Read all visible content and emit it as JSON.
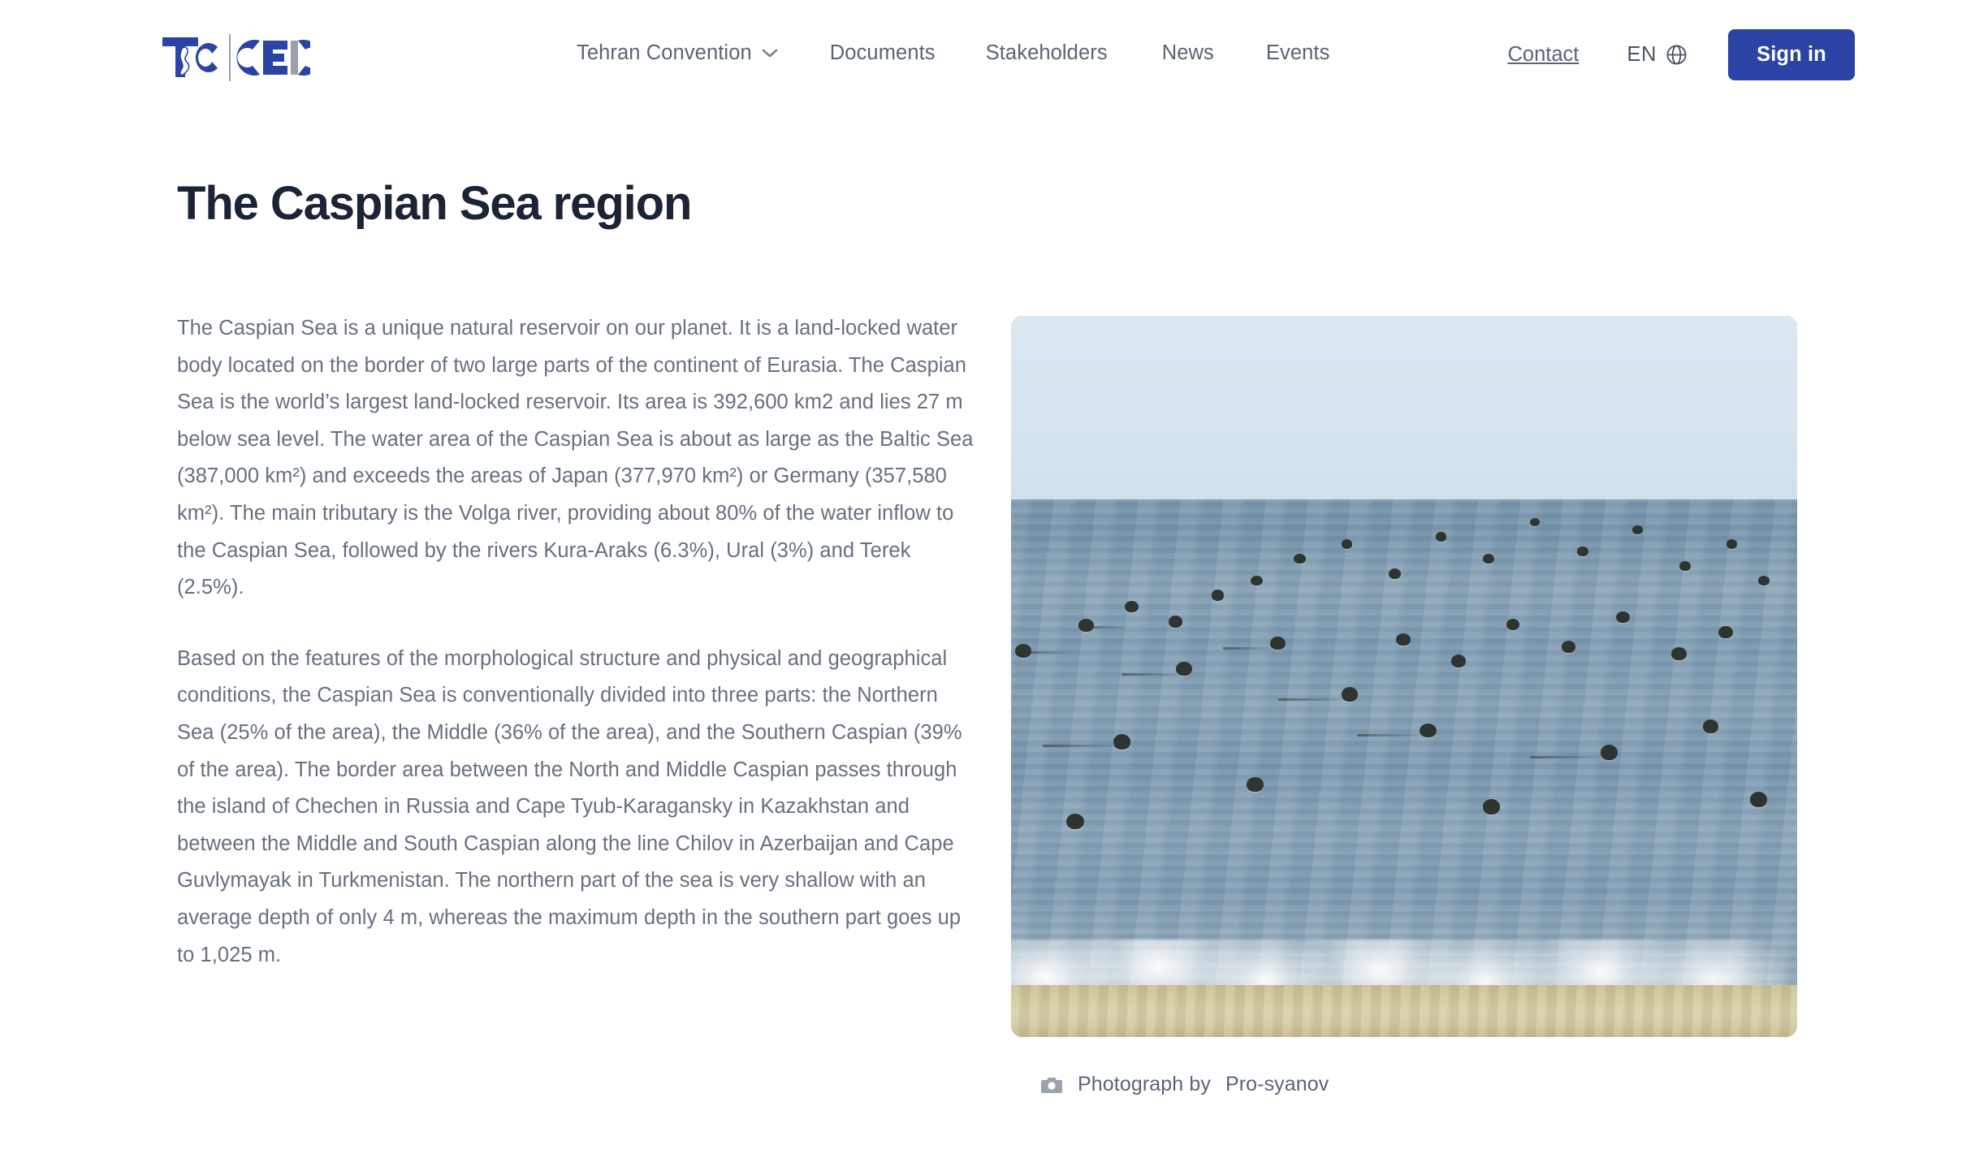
{
  "brand": {
    "logo_primary": "TC",
    "logo_secondary": "CEIC",
    "logo_alt": "Tehran Convention CEIC logo",
    "color_blue": "#2a43a4",
    "color_gray": "#8a8f99"
  },
  "header": {
    "nav": [
      {
        "label": "Tehran Convention",
        "has_dropdown": true,
        "icon": "chevron-down-icon"
      },
      {
        "label": "Documents",
        "has_dropdown": false
      },
      {
        "label": "Stakeholders",
        "has_dropdown": false
      },
      {
        "label": "News",
        "has_dropdown": false
      },
      {
        "label": "Events",
        "has_dropdown": false
      }
    ],
    "contact_label": "Contact",
    "language": {
      "code": "EN",
      "icon": "globe-icon"
    },
    "signin_label": "Sign in"
  },
  "main": {
    "title": "The Caspian Sea region",
    "paragraphs": [
      "The Caspian Sea is a unique natural reservoir on our planet. It is a land-locked water body located on the border of two large parts of the continent of Eurasia. The Caspian Sea is the world’s largest land-locked reservoir. Its area is 392,600 km2 and lies 27 m below sea level. The water area of the Caspian Sea is about as large as the Baltic Sea (387,000 km²) and exceeds the areas of Japan (377,970 km²) or Germany (357,580 km²). The main tributary is the Volga river, providing about 80% of the water inflow to the Caspian Sea, followed by the rivers Kura-Araks (6.3%), Ural (3%) and Terek (2.5%).",
      "Based on the features of the morphological structure and physical and geographical conditions, the Caspian Sea is conventionally divided into three parts: the Northern Sea (25% of the area), the Middle (36% of the area), and the Southern Caspian (39% of the area). The border area between the North and Middle Caspian passes through the island of Chechen in Russia and Cape Tyub-Karagansky in Kazakhstan and between the Middle and South Caspian along the line Chilov in Azerbaijan and Cape Guvlymayak in Turkmenistan. The northern part of the sea is very shallow with an average depth of only 4 m, whereas the maximum depth in the southern part goes up to 1,025 m."
    ]
  },
  "figure": {
    "alt": "Caspian seals swimming near the shore of the Caspian Sea",
    "caption_prefix": "Photograph by",
    "caption_author": "Pro-syanov",
    "caption_icon": "camera-icon"
  }
}
